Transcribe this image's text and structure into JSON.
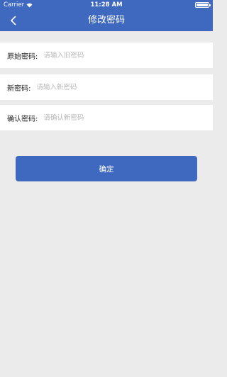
{
  "status_bar": {
    "carrier": "Carrier",
    "time": "11:28 AM",
    "wifi_icon": "wifi-icon",
    "battery_icon": "battery-icon",
    "battery_level": 1.0
  },
  "nav": {
    "title": "修改密码",
    "back_icon": "chevron-left-icon"
  },
  "form": {
    "old_password": {
      "label": "原始密码:",
      "placeholder": "请输入旧密码",
      "value": ""
    },
    "new_password": {
      "label": "新密码:",
      "placeholder": "请输入新密码",
      "value": ""
    },
    "confirm_password": {
      "label": "确认密码:",
      "placeholder": "请确认新密码",
      "value": ""
    }
  },
  "actions": {
    "confirm_label": "确定"
  },
  "colors": {
    "primary": "#3f68bf",
    "background": "#ebebeb",
    "row_background": "#ffffff",
    "placeholder": "#b8b8b8"
  }
}
